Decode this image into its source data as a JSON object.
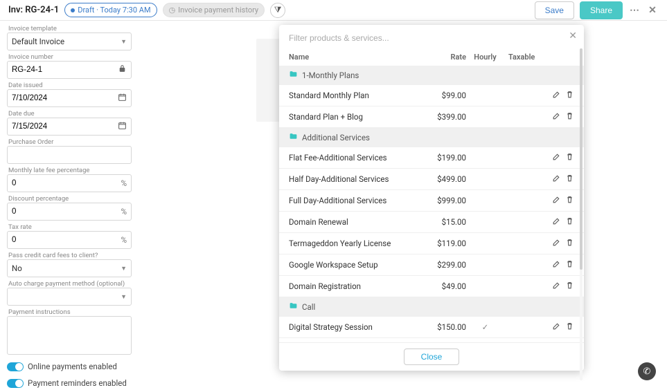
{
  "header": {
    "title": "Inv: RG-24-1",
    "draft_label": "Draft · Today 7:30 AM",
    "history_label": "Invoice payment history",
    "save_label": "Save",
    "share_label": "Share"
  },
  "form": {
    "template_label": "Invoice template",
    "template_value": "Default Invoice",
    "number_label": "Invoice number",
    "number_value": "RG-24-1",
    "issued_label": "Date issued",
    "issued_value": "7/10/2024",
    "due_label": "Date due",
    "due_value": "7/15/2024",
    "po_label": "Purchase Order",
    "po_value": "",
    "late_label": "Monthly late fee percentage",
    "late_value": "0",
    "discount_label": "Discount percentage",
    "discount_value": "0",
    "tax_label": "Tax rate",
    "tax_value": "0",
    "pass_label": "Pass credit card fees to client?",
    "pass_value": "No",
    "auto_label": "Auto charge payment method (optional)",
    "auto_value": "",
    "instructions_label": "Payment instructions",
    "toggle_online": "Online payments enabled",
    "toggle_reminders": "Payment reminders enabled",
    "percent": "%"
  },
  "modal": {
    "filter_placeholder": "Filter products & services...",
    "col_name": "Name",
    "col_rate": "Rate",
    "col_hourly": "Hourly",
    "col_tax": "Taxable",
    "close_label": "Close",
    "groups": [
      {
        "category": "1-Monthly Plans",
        "items": [
          {
            "name": "Standard Monthly Plan",
            "rate": "$99.00",
            "hourly": ""
          },
          {
            "name": "Standard Plan + Blog",
            "rate": "$399.00",
            "hourly": ""
          }
        ]
      },
      {
        "category": "Additional Services",
        "items": [
          {
            "name": "Flat Fee-Additional Services",
            "rate": "$199.00",
            "hourly": ""
          },
          {
            "name": "Half Day-Additional Services",
            "rate": "$499.00",
            "hourly": ""
          },
          {
            "name": "Full Day-Additional Services",
            "rate": "$999.00",
            "hourly": ""
          },
          {
            "name": "Domain Renewal",
            "rate": "$15.00",
            "hourly": ""
          },
          {
            "name": "Termageddon Yearly License",
            "rate": "$119.00",
            "hourly": ""
          },
          {
            "name": "Google Workspace Setup",
            "rate": "$299.00",
            "hourly": ""
          },
          {
            "name": "Domain Registration",
            "rate": "$49.00",
            "hourly": ""
          }
        ]
      },
      {
        "category": "Call",
        "items": [
          {
            "name": "Digital Strategy Session",
            "rate": "$150.00",
            "hourly": "✓"
          }
        ]
      }
    ]
  }
}
